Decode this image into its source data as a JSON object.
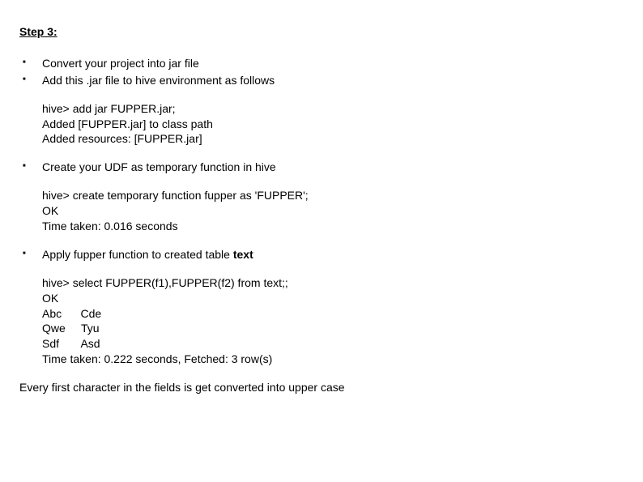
{
  "heading": "Step 3:",
  "bullets": {
    "b1": "Convert your project into jar file",
    "b2": "Add this  .jar file to hive environment as follows",
    "b3": "Create your UDF as temporary function in hive",
    "b4_prefix": "Apply fupper function to created table ",
    "b4_bold": "text"
  },
  "code1": "hive> add jar FUPPER.jar;\nAdded [FUPPER.jar] to class path\nAdded resources: [FUPPER.jar]",
  "code2": "hive> create temporary function fupper as 'FUPPER';\nOK\nTime taken: 0.016 seconds",
  "code3": "hive> select FUPPER(f1),FUPPER(f2) from text;;\nOK\nAbc      Cde\nQwe     Tyu\nSdf       Asd\nTime taken: 0.222 seconds, Fetched: 3 row(s)",
  "closing": "Every first character in the fields is get converted into  upper case"
}
